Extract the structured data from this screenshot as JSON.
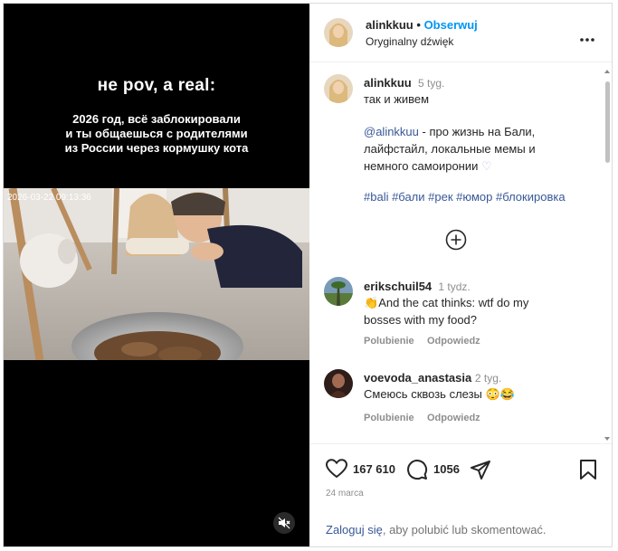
{
  "video": {
    "title": "не pov, a real:",
    "subtitle_lines": [
      "2026 год, всё заблокировали",
      "и ты общаешься с родителями",
      "из России через кормушку кота"
    ],
    "timestamp": "2026-03-22 09:13:36"
  },
  "header": {
    "username": "alinkkuu",
    "separator": "•",
    "follow_label": "Obserwuj",
    "audio_label": "Oryginalny dźwięk"
  },
  "post": {
    "username": "alinkkuu",
    "time": "5 tyg.",
    "caption_line": "так и живем",
    "mention": "@alinkkuu",
    "bio_1": " - про жизнь на Бали,",
    "bio_2": "лайфстайл, локальные мемы и",
    "bio_3": "немного самоиронии",
    "hashtags": "#bali #бали #рек #юмор #блокировка"
  },
  "comments": [
    {
      "username": "erikschuil54",
      "time": "1 tydz.",
      "line_1": "And the cat thinks: wtf do my",
      "line_2": "bosses with my food?",
      "like_label": "Polubienie",
      "reply_label": "Odpowiedz"
    },
    {
      "username": "voevoda_anastasia",
      "time": "2 tyg.",
      "line_1": "Смеюсь сквозь слезы",
      "like_label": "Polubienie",
      "reply_label": "Odpowiedz"
    }
  ],
  "footer": {
    "likes": "167 610",
    "comments": "1056",
    "date": "24 marca",
    "login_link": "Zaloguj się",
    "login_rest": ", aby polubić lub skomentować."
  },
  "colors": {
    "link": "#385898",
    "follow": "#0095f6",
    "muted": "#8e8e8e"
  }
}
